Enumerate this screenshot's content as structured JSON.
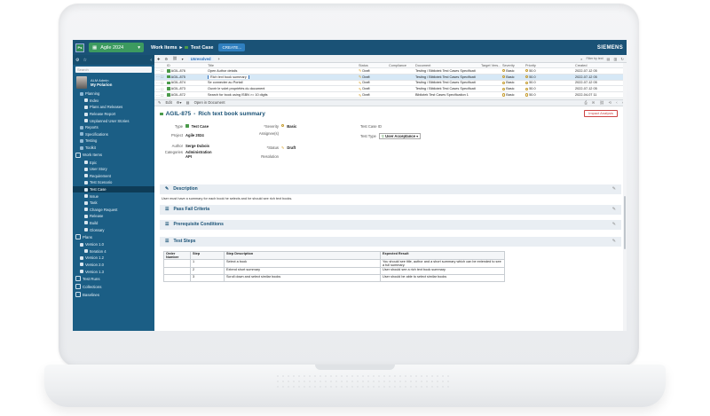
{
  "topbar": {
    "logo": "Ps",
    "project": "Agile 2024",
    "crumb_work_items": "Work Items",
    "crumb_sep": "▸",
    "crumb_current": "Test Case",
    "create": "CREATE...",
    "brand": "SIEMENS"
  },
  "sidebar": {
    "search_placeholder": "Search",
    "user_role": "ALM Admin",
    "user_name": "My Polarion",
    "items": [
      {
        "label": "Planning",
        "level": 1,
        "type": "group"
      },
      {
        "label": "Index",
        "level": 2
      },
      {
        "label": "Plans and Releases",
        "level": 2
      },
      {
        "label": "Release Report",
        "level": 2
      },
      {
        "label": "Unplanned User Stories",
        "level": 2
      },
      {
        "label": "Reports",
        "level": 1,
        "type": "folder"
      },
      {
        "label": "Specifications",
        "level": 1,
        "type": "folder"
      },
      {
        "label": "Testing",
        "level": 1,
        "type": "folder"
      },
      {
        "label": "Toolkit",
        "level": 1,
        "type": "folder"
      },
      {
        "label": "Work Items",
        "level": 0,
        "type": "big"
      },
      {
        "label": "Epic",
        "level": 2
      },
      {
        "label": "User Story",
        "level": 2
      },
      {
        "label": "Requirement",
        "level": 2
      },
      {
        "label": "Test Scenario",
        "level": 2
      },
      {
        "label": "Test Case",
        "level": 2,
        "selected": true
      },
      {
        "label": "Issue",
        "level": 2
      },
      {
        "label": "Task",
        "level": 2
      },
      {
        "label": "Change Request",
        "level": 2
      },
      {
        "label": "Release",
        "level": 2
      },
      {
        "label": "Build",
        "level": 2
      },
      {
        "label": "Glossary",
        "level": 2
      },
      {
        "label": "Plans",
        "level": 0,
        "type": "big"
      },
      {
        "label": "Version 1.0",
        "level": 1
      },
      {
        "label": "Iteration 4",
        "level": 2
      },
      {
        "label": "Version 1.2",
        "level": 1
      },
      {
        "label": "Version 2.0",
        "level": 1
      },
      {
        "label": "Version 1.3",
        "level": 1
      },
      {
        "label": "Test Runs",
        "level": 0,
        "type": "big"
      },
      {
        "label": "Collections",
        "level": 0,
        "type": "big"
      },
      {
        "label": "Baselines",
        "level": 0,
        "type": "big"
      }
    ]
  },
  "toolbar": {
    "query": "Unresolved",
    "search_hint": "Filter by text",
    "zoom": "100"
  },
  "grid": {
    "headers": {
      "id": "ID",
      "title": "Title",
      "status": "Status",
      "compliance": "Compliance",
      "document": "Document",
      "target_version": "Target Vers...",
      "severity": "Severity",
      "priority": "Priority",
      "created": "Created"
    },
    "rows": [
      {
        "id": "AGIL-876",
        "title": "Open Author details",
        "status": "Draft",
        "document": "Testing / Bibliotek Test Cases Specificati",
        "severity": "Basic",
        "priority": "50.0",
        "created": "2022-07-12 05"
      },
      {
        "id": "AGIL-875",
        "title": "Rich text book summary",
        "status": "Draft",
        "document": "Testing / Bibliotek Test Cases Specificati",
        "severity": "Basic",
        "priority": "50.0",
        "created": "2022-07-12 05",
        "selected": true
      },
      {
        "id": "AGIL-874",
        "title": "Se connecter au Portail",
        "status": "Draft",
        "document": "Testing / Bibliotek Test Cases Specificati",
        "severity": "Basic",
        "priority": "50.0",
        "created": "2022-07-12 05"
      },
      {
        "id": "AGIL-873",
        "title": "Ouvrir le volet propriétés du document",
        "status": "Draft",
        "document": "Testing / Bibliotek Test Cases Specificati",
        "severity": "Basic",
        "priority": "50.0",
        "created": "2022-07-12 05"
      },
      {
        "id": "AGIL-872",
        "title": "Search for book using ISBN >= 10 digits",
        "status": "Draft",
        "document": "Bibliotek Test Cases Specification 1",
        "severity": "Basic",
        "priority": "50.0",
        "created": "2022-04-07 11"
      }
    ]
  },
  "detail_bar": {
    "edit": "Edit",
    "open_in_document": "Open in Document"
  },
  "detail": {
    "id": "AGIL-875",
    "title": "Rich text book summary",
    "impact_analysis": "Impact Analysis",
    "type_label": "Type",
    "type_value": "Test Case",
    "project_label": "Project",
    "project_value": "Agile 2024",
    "author_label": "Author",
    "author_value": "Serge Dubois",
    "categories_label": "Categories",
    "categories_value_1": "Administration",
    "categories_value_2": "API",
    "severity_label": "*Severity",
    "severity_value": "Basic",
    "assignee_label": "Assignee(s)",
    "status_label": "*Status",
    "status_value": "Draft",
    "resolution_label": "Resolution",
    "testcase_id_label": "Test Case ID",
    "test_type_label": "Test Type",
    "test_type_value": "User Acceptance"
  },
  "sections": {
    "description": "Description",
    "description_text": "User must have a summary for each book he selects and he should see rich text books.",
    "pass_fail": "Pass Fail Criteria",
    "prerequisite": "Prerequisite Conditions",
    "test_steps": "Test Steps"
  },
  "steps": {
    "headers": {
      "order": "Order Number",
      "step": "Step",
      "desc": "Step Description",
      "expected": "Expected Result"
    },
    "rows": [
      {
        "order": "",
        "step": "1",
        "desc": "Select a book",
        "expected": "You should see title, author and a short summary which can be extended to see a full summary."
      },
      {
        "order": "",
        "step": "2",
        "desc": "Extend short summary",
        "expected": "User should see a rich text book summary"
      },
      {
        "order": "",
        "step": "3",
        "desc": "Scroll down and select similar books",
        "expected": "User should be able to select similar books"
      }
    ]
  }
}
